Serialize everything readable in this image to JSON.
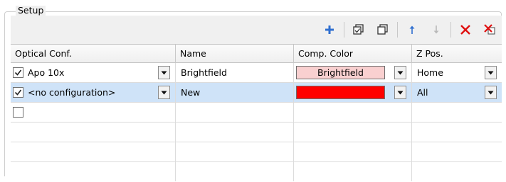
{
  "group": {
    "title": "Setup"
  },
  "toolbar": {
    "icons": [
      "add-icon",
      "duplicate-icon",
      "copy-icon",
      "move-up-icon",
      "move-down-icon",
      "delete-icon",
      "delete-all-icon"
    ]
  },
  "colors": {
    "add": "#2f6fd0",
    "delete": "#e01010",
    "disabled": "#b9b9b9",
    "selected_row": "#cfe3f8",
    "brightfield_swatch": "#f9d0d0",
    "new_swatch": "#ff0000"
  },
  "table": {
    "columns": [
      "Optical Conf.",
      "Name",
      "Comp. Color",
      "Z Pos."
    ],
    "rows": [
      {
        "checked": true,
        "optical_conf": "Apo 10x",
        "name": "Brightfield",
        "comp_color_label": "Brightfield",
        "comp_color": "#f9d0d0",
        "z_pos": "Home",
        "selected": false
      },
      {
        "checked": true,
        "optical_conf": "<no configuration>",
        "name": "New",
        "comp_color_label": "",
        "comp_color": "#ff0000",
        "z_pos": "All",
        "selected": true
      },
      {
        "checked": false,
        "optical_conf": "",
        "name": "",
        "comp_color_label": "",
        "comp_color": "",
        "z_pos": "",
        "selected": false
      }
    ]
  }
}
